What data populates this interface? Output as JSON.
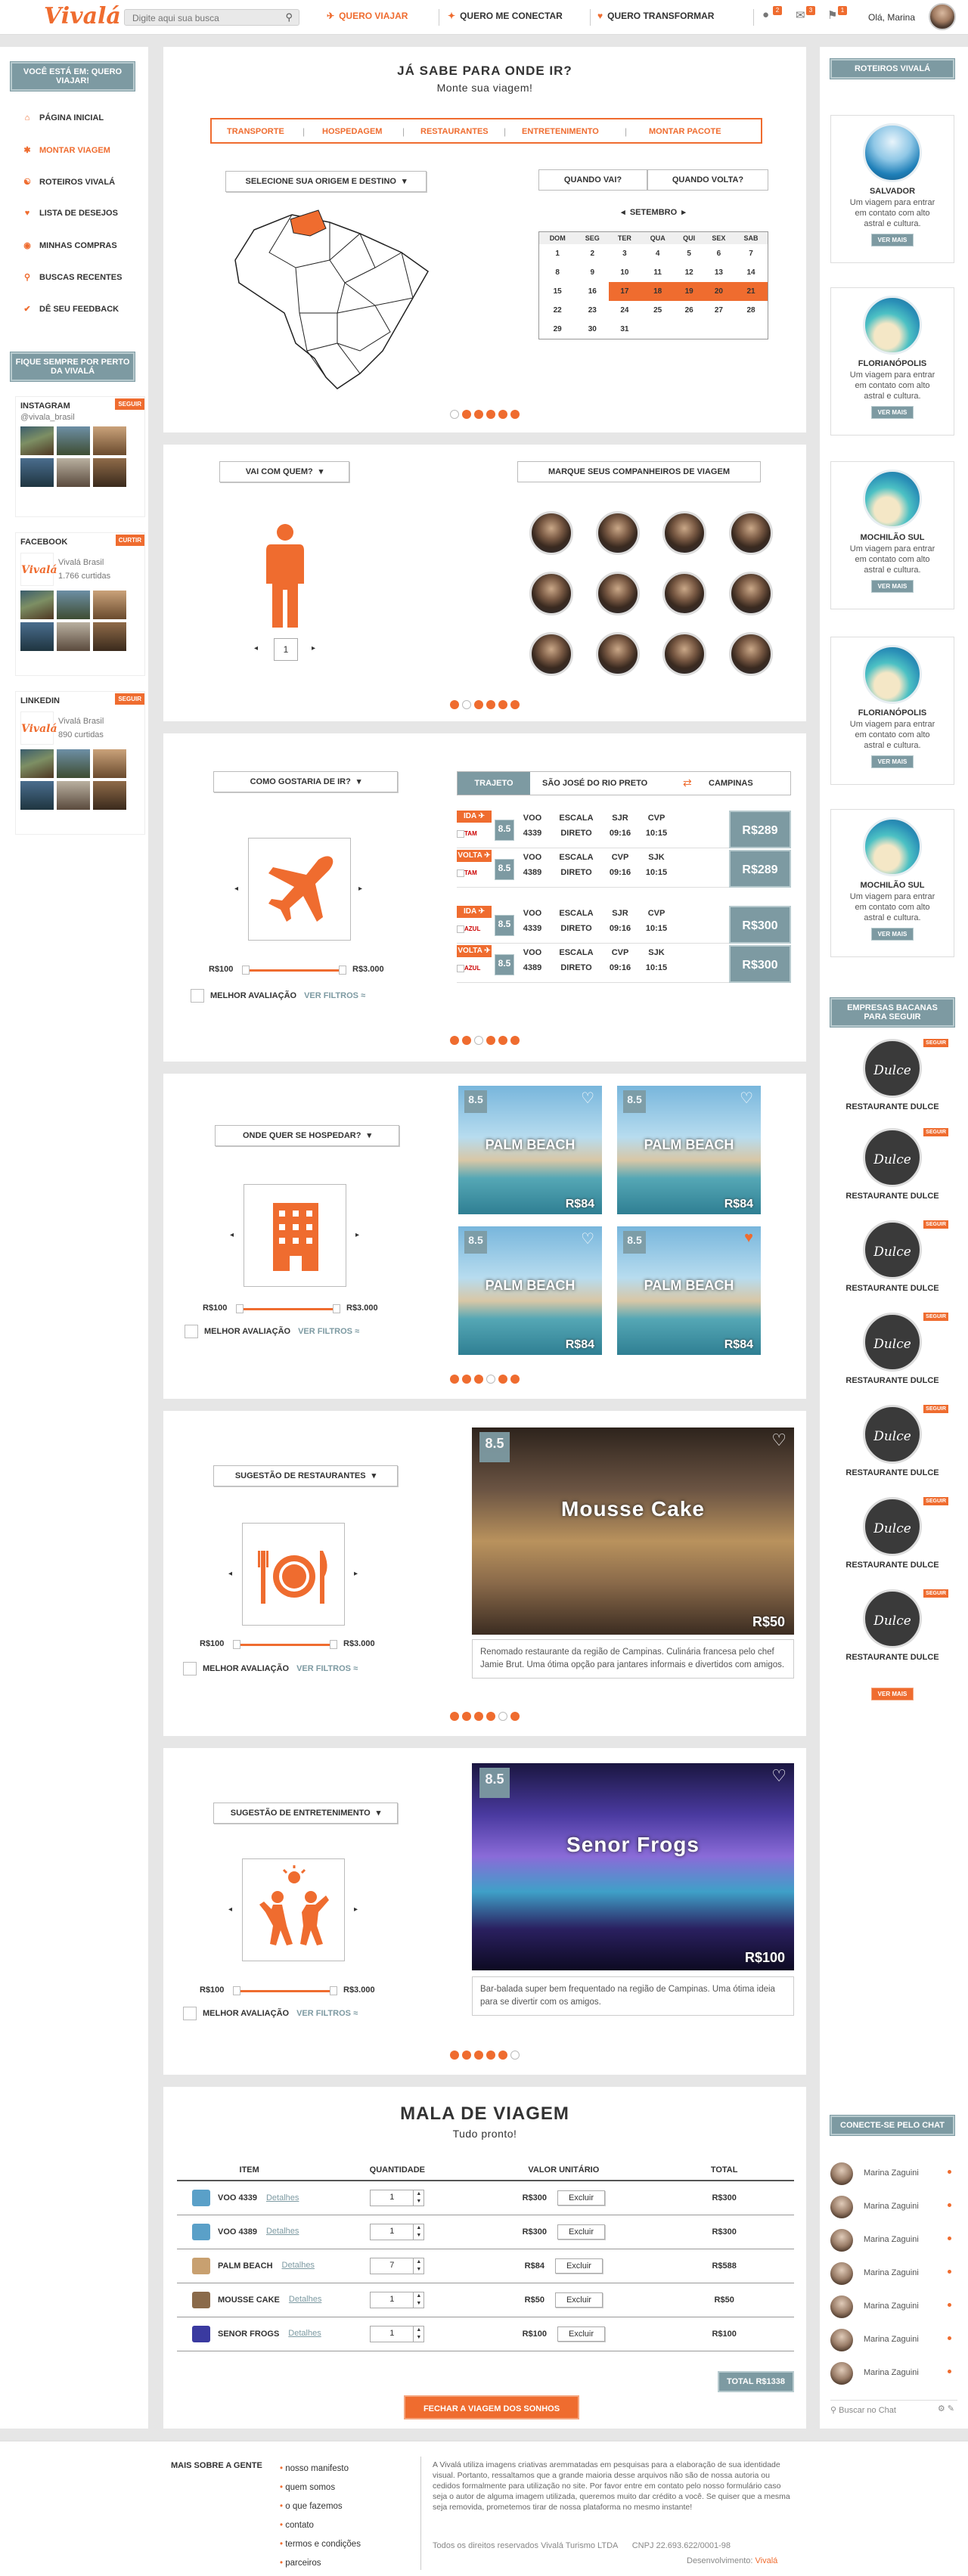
{
  "header": {
    "logo": "Vivalá",
    "search_placeholder": "Digite aqui sua busca",
    "nav": [
      "QUERO VIAJAR",
      "QUERO ME CONECTAR",
      "QUERO TRANSFORMAR"
    ],
    "notifications": [
      "2",
      "3",
      "1"
    ],
    "greeting": "Olá, Marina"
  },
  "left_sidebar": {
    "heading": "VOCÊ ESTÁ EM: QUERO VIAJAR!",
    "menu": [
      "PÁGINA INICIAL",
      "MONTAR VIAGEM",
      "ROTEIROS VIVALÁ",
      "LISTA DE DESEJOS",
      "MINHAS COMPRAS",
      "BUSCAS RECENTES",
      "DÊ SEU FEEDBACK"
    ],
    "active_item": "MONTAR VIAGEM",
    "social_heading": "FIQUE SEMPRE POR PERTO DA VIVALÁ",
    "social": [
      {
        "name": "INSTAGRAM",
        "button": "SEGUIR",
        "line1": "@vivala_brasil",
        "line2": ""
      },
      {
        "name": "FACEBOOK",
        "button": "CURTIR",
        "line1": "Vivalá Brasil",
        "line2": "1.766 curtidas"
      },
      {
        "name": "LINKEDIN",
        "button": "SEGUIR",
        "line1": "Vivalá Brasil",
        "line2": "890 curtidas"
      }
    ]
  },
  "right_sidebar": {
    "roteiros_heading": "ROTEIROS VIVALÁ",
    "roteiros": [
      {
        "name": "SALVADOR",
        "desc": "Um viagem para entrar em contato com alto astral e cultura.",
        "btn": "VER MAIS"
      },
      {
        "name": "FLORIANÓPOLIS",
        "desc": "Um viagem para entrar em contato com alto astral e cultura.",
        "btn": "VER MAIS"
      },
      {
        "name": "MOCHILÃO SUL",
        "desc": "Um viagem para entrar em contato com alto astral e cultura.",
        "btn": "VER MAIS"
      },
      {
        "name": "FLORIANÓPOLIS",
        "desc": "Um viagem para entrar em contato com alto astral e cultura.",
        "btn": "VER MAIS"
      },
      {
        "name": "MOCHILÃO SUL",
        "desc": "Um viagem para entrar em contato com alto astral e cultura.",
        "btn": "VER MAIS"
      }
    ],
    "companies_heading": "EMPRESAS BACANAS PARA SEGUIR",
    "company_logo": "Dulce",
    "company_follow": "SEGUIR",
    "companies": [
      "RESTAURANTE DULCE",
      "RESTAURANTE DULCE",
      "RESTAURANTE DULCE",
      "RESTAURANTE DULCE",
      "RESTAURANTE DULCE",
      "RESTAURANTE DULCE",
      "RESTAURANTE DULCE"
    ],
    "companies_more": "VER MAIS",
    "chat_heading": "CONECTE-SE PELO CHAT",
    "chat_users": [
      "Marina Zaguini",
      "Marina Zaguini",
      "Marina Zaguini",
      "Marina Zaguini",
      "Marina Zaguini",
      "Marina Zaguini",
      "Marina Zaguini"
    ],
    "chat_search": "Buscar no Chat"
  },
  "destination": {
    "title": "JÁ SABE PARA ONDE IR?",
    "subtitle": "Monte sua viagem!",
    "tabs": [
      "TRANSPORTE",
      "HOSPEDAGEM",
      "RESTAURANTES",
      "ENTRETENIMENTO",
      "MONTAR PACOTE"
    ],
    "origin_select": "SELECIONE SUA ORIGEM E DESTINO",
    "when_go": "QUANDO VAI?",
    "when_back": "QUANDO VOLTA?",
    "month": "SETEMBRO",
    "weekdays": [
      "DOM",
      "SEG",
      "TER",
      "QUA",
      "QUI",
      "SEX",
      "SAB"
    ],
    "weeks": [
      [
        "1",
        "2",
        "3",
        "4",
        "5",
        "6",
        "7"
      ],
      [
        "8",
        "9",
        "10",
        "11",
        "12",
        "13",
        "14"
      ],
      [
        "15",
        "16",
        "17",
        "18",
        "19",
        "20",
        "21"
      ],
      [
        "22",
        "23",
        "24",
        "25",
        "26",
        "27",
        "28"
      ],
      [
        "29",
        "30",
        "31",
        "",
        "",
        "",
        ""
      ]
    ],
    "highlighted": [
      "17",
      "18",
      "19",
      "20",
      "21"
    ]
  },
  "companions": {
    "who_select": "VAI COM QUEM?",
    "mark_label": "MARQUE SEUS COMPANHEIROS DE VIAGEM",
    "count": "1"
  },
  "transport": {
    "how_select": "COMO GOSTARIA DE IR?",
    "route_label": "TRAJETO",
    "from": "SÃO JOSÉ DO RIO PRETO",
    "to": "CAMPINAS",
    "price_min": "R$100",
    "price_max": "R$3.000",
    "best_rating": "MELHOR AVALIAÇÃO",
    "filters": "VER FILTROS",
    "flights": [
      {
        "dir": "IDA",
        "airline": "TAM",
        "score": "8.5",
        "cols": [
          "VOO",
          "ESCALA",
          "SJR",
          "CVP",
          "4339",
          "DIRETO",
          "09:16",
          "10:15"
        ],
        "price": "R$289"
      },
      {
        "dir": "VOLTA",
        "airline": "TAM",
        "score": "8.5",
        "cols": [
          "VOO",
          "ESCALA",
          "CVP",
          "SJK",
          "4389",
          "DIRETO",
          "09:16",
          "10:15"
        ],
        "price": "R$289"
      },
      {
        "dir": "IDA",
        "airline": "AZUL",
        "score": "8.5",
        "cols": [
          "VOO",
          "ESCALA",
          "SJR",
          "CVP",
          "4339",
          "DIRETO",
          "09:16",
          "10:15"
        ],
        "price": "R$300"
      },
      {
        "dir": "VOLTA",
        "airline": "AZUL",
        "score": "8.5",
        "cols": [
          "VOO",
          "ESCALA",
          "CVP",
          "SJK",
          "4389",
          "DIRETO",
          "09:16",
          "10:15"
        ],
        "price": "R$300"
      }
    ]
  },
  "hotels": {
    "where_select": "ONDE QUER SE HOSPEDAR?",
    "price_min": "R$100",
    "price_max": "R$3.000",
    "best_rating": "MELHOR AVALIAÇÃO",
    "filters": "VER FILTROS",
    "items": [
      {
        "score": "8.5",
        "name": "PALM BEACH",
        "price": "R$84"
      },
      {
        "score": "8.5",
        "name": "PALM BEACH",
        "price": "R$84"
      },
      {
        "score": "8.5",
        "name": "PALM BEACH",
        "price": "R$84"
      },
      {
        "score": "8.5",
        "name": "PALM BEACH",
        "price": "R$84"
      }
    ]
  },
  "restaurants": {
    "select": "SUGESTÃO DE RESTAURANTES",
    "price_min": "R$100",
    "price_max": "R$3.000",
    "best_rating": "MELHOR AVALIAÇÃO",
    "filters": "VER FILTROS",
    "score": "8.5",
    "name": "Mousse Cake",
    "price": "R$50",
    "desc": "Renomado restaurante da região de Campinas. Culinária francesa pelo chef Jamie Brut. Uma ótima opção para jantares informais e divertidos com amigos."
  },
  "entertainment": {
    "select": "SUGESTÃO DE ENTRETENIMENTO",
    "price_min": "R$100",
    "price_max": "R$3.000",
    "best_rating": "MELHOR AVALIAÇÃO",
    "filters": "VER FILTROS",
    "score": "8.5",
    "name": "Senor Frogs",
    "price": "R$100",
    "desc": "Bar-balada super bem frequentado na região de Campinas.  Uma ótima ideia para se divertir com os amigos."
  },
  "suitcase": {
    "title": "MALA DE VIAGEM",
    "subtitle": "Tudo pronto!",
    "headers": [
      "ITEM",
      "QUANTIDADE",
      "VALOR UNITÁRIO",
      "TOTAL"
    ],
    "details": "Detalhes",
    "remove": "Excluir",
    "rows": [
      {
        "item": "VOO 4339",
        "qty": "1",
        "unit": "R$300",
        "total": "R$300"
      },
      {
        "item": "VOO 4389",
        "qty": "1",
        "unit": "R$300",
        "total": "R$300"
      },
      {
        "item": "PALM BEACH",
        "qty": "7",
        "unit": "R$84",
        "total": "R$588"
      },
      {
        "item": "MOUSSE CAKE",
        "qty": "1",
        "unit": "R$50",
        "total": "R$50"
      },
      {
        "item": "SENOR FROGS",
        "qty": "1",
        "unit": "R$100",
        "total": "R$100"
      }
    ],
    "total": "TOTAL R$1338",
    "checkout": "FECHAR A VIAGEM DOS SONHOS"
  },
  "footer": {
    "heading": "MAIS SOBRE A GENTE",
    "links": [
      "nosso manifesto",
      "quem somos",
      "o que fazemos",
      "contato",
      "termos e condições",
      "parceiros"
    ],
    "disclaimer": "A Vivalá utiliza imagens criativas aremmatadas em pesquisas para a elaboração de sua identidade visual. Portanto, ressaltamos que a grande maioria desse arquivos não são de nossa autoria ou cedidos formalmente para utilização no site. Por favor entre em contato pelo nosso formulário caso seja o autor de alguma imagem utilizada, queremos muito dar crédito a você. Se quiser que a mesma seja removida, prometemos tirar de nossa plataforma no mesmo instante!",
    "rights": "Todos os direitos reservados Vivalá Turismo LTDA",
    "cnpj": "CNPJ 22.693.622/0001-98",
    "dev_label": "Desenvolvimento:",
    "dev": "Vivalá"
  },
  "colors": {
    "accent": "#ef6c2f",
    "slate": "#7d9aa2"
  }
}
